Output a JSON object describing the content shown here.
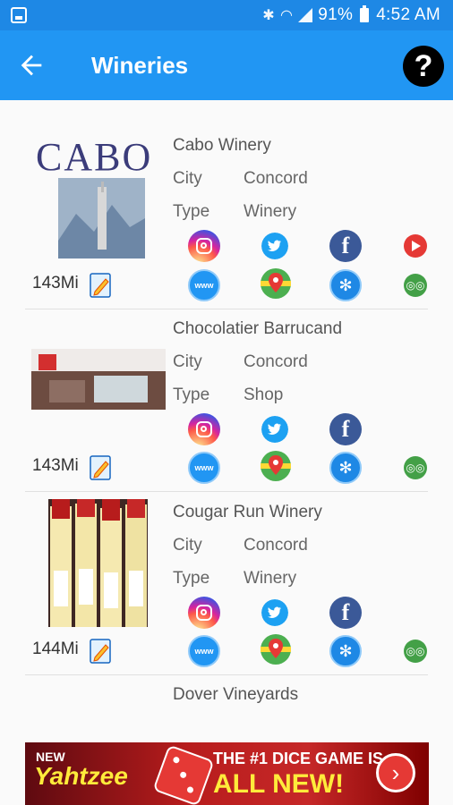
{
  "status_bar": {
    "battery": "91%",
    "time": "4:52 AM"
  },
  "app_bar": {
    "title": "Wineries"
  },
  "wineries": [
    {
      "name": "Cabo Winery",
      "city_label": "City",
      "city": "Concord",
      "type_label": "Type",
      "type": "Winery",
      "distance": "143Mi",
      "logo_text": "CABO"
    },
    {
      "name": "Chocolatier Barrucand",
      "city_label": "City",
      "city": "Concord",
      "type_label": "Type",
      "type": "Shop",
      "distance": "143Mi"
    },
    {
      "name": "Cougar Run Winery",
      "city_label": "City",
      "city": "Concord",
      "type_label": "Type",
      "type": "Winery",
      "distance": "144Mi"
    },
    {
      "name": "Dover Vineyards"
    }
  ],
  "icons": {
    "fb": "f",
    "www": "www",
    "yelp": "✻",
    "trip": "◎◎"
  },
  "ad": {
    "tag": "NEW",
    "brand": "Yahtzee",
    "headline": "THE #1 DICE GAME IS",
    "subline": "ALL NEW!"
  },
  "colors": {
    "primary": "#2196f3",
    "status": "#1e88e5"
  }
}
